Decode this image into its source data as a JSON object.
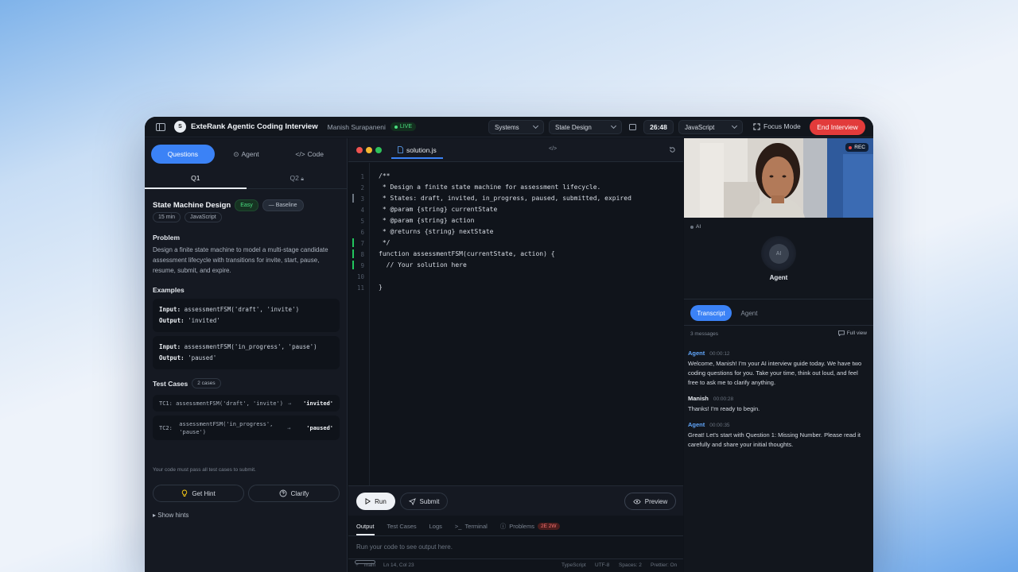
{
  "header": {
    "logo_letter": "S",
    "app_title": "ExteRank Agentic Coding Interview",
    "user_name": "Manish Surapaneni",
    "live_label": "LIVE",
    "category_select": "Systems",
    "topic_select": "State Design",
    "timer": "26:48",
    "language_select": "JavaScript",
    "focus_mode": "Focus Mode",
    "end_button": "End Interview"
  },
  "left": {
    "segments": [
      "Questions",
      "Agent",
      "Code"
    ],
    "question_tabs": [
      "Q1",
      "Q2"
    ],
    "question": {
      "title": "State Machine Design",
      "difficulty": "Easy",
      "baseline": "— Baseline",
      "duration": "15 min",
      "language": "JavaScript",
      "problem_heading": "Problem",
      "problem_text": "Design a finite state machine to model a multi-stage candidate assessment lifecycle with transitions for invite, start, pause, resume, submit, and expire.",
      "examples_heading": "Examples",
      "examples": [
        {
          "input_label": "Input:",
          "input": " assessmentFSM('draft', 'invite')",
          "output_label": "Output:",
          "output": " 'invited'"
        },
        {
          "input_label": "Input:",
          "input": " assessmentFSM('in_progress', 'pause')",
          "output_label": "Output:",
          "output": " 'paused'"
        }
      ],
      "test_cases_heading": "Test Cases",
      "test_cases_count": "2 cases",
      "test_cases": [
        {
          "id": "TC1:",
          "call": "assessmentFSM('draft', 'invite')",
          "arrow": "→",
          "expected": "'invited'"
        },
        {
          "id": "TC2:",
          "call": "assessmentFSM('in_progress', 'pause')",
          "arrow": "→",
          "expected": "'paused'"
        }
      ],
      "must_pass": "Your code must pass all test cases to submit.",
      "hint_button": "Get Hint",
      "clarify_button": "Clarify",
      "show_hints": "▸ Show hints"
    }
  },
  "editor": {
    "file_name": "solution.js",
    "lines": [
      "/**",
      " * Design a finite state machine for assessment lifecycle.",
      " * States: draft, invited, in_progress, paused, submitted, expired",
      " * @param {string} currentState",
      " * @param {string} action",
      " * @returns {string} nextState",
      " */",
      "function assessmentFSM(currentState, action) {",
      "  // Your solution here",
      "",
      "}"
    ],
    "line_numbers": [
      "1",
      "2",
      "3",
      "4",
      "5",
      "6",
      "7",
      "8",
      "9",
      "10",
      "11"
    ],
    "run_button": "Run",
    "submit_button": "Submit",
    "preview_button": "Preview",
    "output_tabs": [
      "Output",
      "Test Cases",
      "Logs",
      "Terminal",
      "Problems"
    ],
    "problems_badge": "2E 2W",
    "output_placeholder": "Run your code to see output here.",
    "status": {
      "branch": "main",
      "position": "Ln 14, Col 23",
      "language": "TypeScript",
      "encoding": "UTF-8",
      "spaces": "Spaces: 2",
      "prettier": "Prettier: On"
    }
  },
  "right": {
    "rec_label": "REC",
    "ai_tag": "AI",
    "ai_avatar": "AI",
    "agent_label": "Agent",
    "tabs": [
      "Transcript",
      "Agent"
    ],
    "message_count": "3 messages",
    "full_view": "Full view",
    "messages": [
      {
        "sender": "Agent",
        "time": "00:00:12",
        "text": "Welcome, Manish! I'm your AI interview guide today. We have two coding questions for you. Take your time, think out loud, and feel free to ask me to clarify anything."
      },
      {
        "sender": "Manish",
        "time": "00:00:28",
        "text": "Thanks! I'm ready to begin."
      },
      {
        "sender": "Agent",
        "time": "00:00:35",
        "text": "Great! Let's start with Question 1: Missing Number. Please read it carefully and share your initial thoughts."
      }
    ]
  },
  "colors": {
    "accent": "#3b82f6",
    "danger": "#e23b3b",
    "success": "#4ade80",
    "agent_name": "#60a5fa"
  }
}
